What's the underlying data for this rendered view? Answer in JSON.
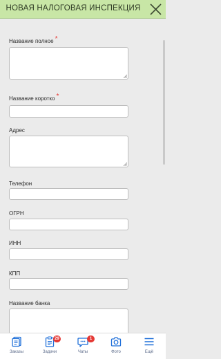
{
  "header": {
    "title": "НОВАЯ НАЛОГОВАЯ ИНСПЕКЦИЯ",
    "close_icon": "close-icon",
    "background": "#c8e6a6"
  },
  "form": {
    "required_mark": "*",
    "fields": [
      {
        "label": "Название полное",
        "required": true,
        "type": "textarea",
        "value": ""
      },
      {
        "label": "Название коротко",
        "required": true,
        "type": "input",
        "value": ""
      },
      {
        "label": "Адрес",
        "required": false,
        "type": "textarea",
        "value": ""
      },
      {
        "label": "Телефон",
        "required": false,
        "type": "input",
        "value": ""
      },
      {
        "label": "ОГРН",
        "required": false,
        "type": "input",
        "value": ""
      },
      {
        "label": "ИНН",
        "required": false,
        "type": "input",
        "value": ""
      },
      {
        "label": "КПП",
        "required": false,
        "type": "input",
        "value": ""
      },
      {
        "label": "Название банка",
        "required": false,
        "type": "textarea",
        "value": ""
      }
    ]
  },
  "tabbar": {
    "accent": "#1e6fd9",
    "tabs": [
      {
        "label": "Заказы",
        "icon": "orders-icon"
      },
      {
        "label": "Задачи",
        "icon": "tasks-icon",
        "badge": "29"
      },
      {
        "label": "Чаты",
        "icon": "chat-icon",
        "badge": "1"
      },
      {
        "label": "Фото",
        "icon": "camera-icon"
      },
      {
        "label": "Ещё",
        "icon": "menu-icon"
      }
    ]
  }
}
